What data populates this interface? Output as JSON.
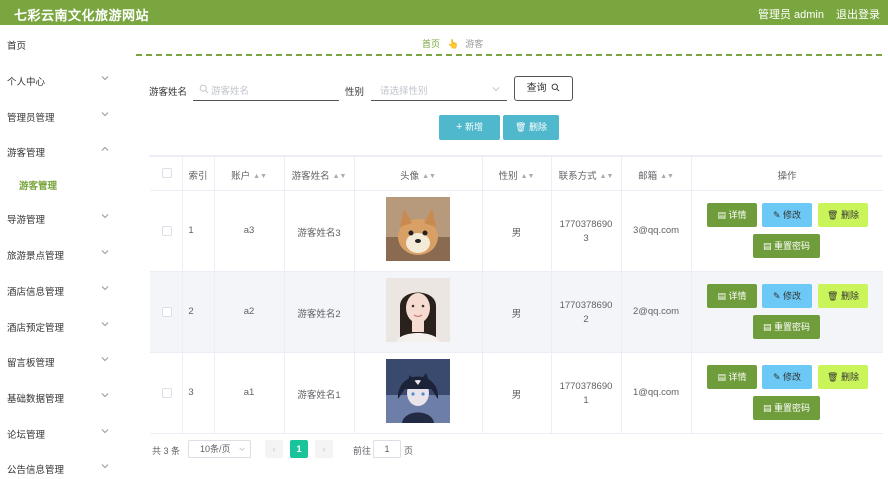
{
  "header": {
    "title": "七彩云南文化旅游网站",
    "user": "管理员 admin",
    "logout": "退出登录"
  },
  "sidebar": {
    "items": [
      {
        "label": "首页",
        "chevron": false
      },
      {
        "label": "个人中心",
        "chevron": true
      },
      {
        "label": "管理员管理",
        "chevron": true
      },
      {
        "label": "游客管理",
        "chevron": true,
        "expanded": true
      },
      {
        "label": "游客管理",
        "sub": true
      },
      {
        "label": "导游管理",
        "chevron": true
      },
      {
        "label": "旅游景点管理",
        "chevron": true
      },
      {
        "label": "酒店信息管理",
        "chevron": true
      },
      {
        "label": "酒店预定管理",
        "chevron": true
      },
      {
        "label": "留言板管理",
        "chevron": true
      },
      {
        "label": "基础数据管理",
        "chevron": true
      },
      {
        "label": "论坛管理",
        "chevron": true
      },
      {
        "label": "公告信息管理",
        "chevron": true
      }
    ]
  },
  "breadcrumb": {
    "home": "首页",
    "current": "游客"
  },
  "search": {
    "name_label": "游客姓名",
    "name_placeholder": "游客姓名",
    "gender_label": "性别",
    "gender_placeholder": "请选择性别",
    "query": "查询"
  },
  "actions": {
    "add": "新增",
    "delete": "删除"
  },
  "table": {
    "headers": [
      "索引",
      "账户",
      "游客姓名",
      "头像",
      "性别",
      "联系方式",
      "邮箱",
      "操作"
    ],
    "rows": [
      {
        "index": "1",
        "account": "a3",
        "name": "游客姓名3",
        "gender": "男",
        "phone1": "1770378690",
        "phone2": "3",
        "email": "3@qq.com",
        "avatar": "dog-photo"
      },
      {
        "index": "2",
        "account": "a2",
        "name": "游客姓名2",
        "gender": "男",
        "phone1": "1770378690",
        "phone2": "2",
        "email": "2@qq.com",
        "avatar": "woman-photo"
      },
      {
        "index": "3",
        "account": "a1",
        "name": "游客姓名1",
        "gender": "男",
        "phone1": "1770378690",
        "phone2": "1",
        "email": "1@qq.com",
        "avatar": "anime-boy-photo"
      }
    ],
    "ops": {
      "detail": "详情",
      "edit": "修改",
      "remove": "删除",
      "reset": "重置密码"
    }
  },
  "pagination": {
    "total": "共 3 条",
    "page_size": "10条/页",
    "current_page": "1",
    "goto": "前往",
    "goto_value": "1",
    "page_suffix": "页"
  },
  "colors": {
    "brand": "#7aa63f",
    "info": "#4fb8cc",
    "edit": "#6cc9f5",
    "remove": "#c9f55a"
  }
}
